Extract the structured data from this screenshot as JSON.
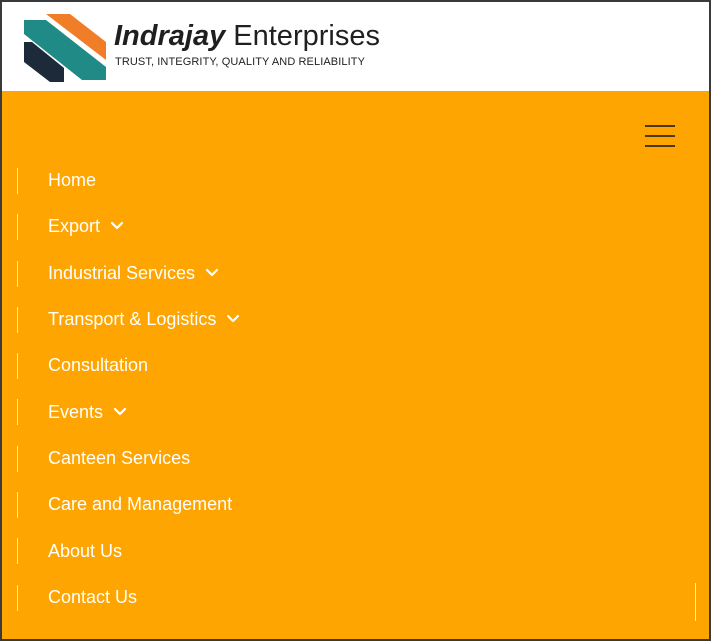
{
  "header": {
    "brand_strong": "Indrajay",
    "brand_light": "Enterprises",
    "tagline": "TRUST, INTEGRITY, QUALITY AND RELIABILITY",
    "logo_icon": "indrajay-logo-icon"
  },
  "colors": {
    "nav_background": "#fea501",
    "logo_teal": "#1f8a86",
    "logo_orange": "#f07d27",
    "logo_navy": "#1c2a3a",
    "menu_text": "#ffffff"
  },
  "nav": {
    "toggle_icon": "hamburger-menu-icon",
    "items": [
      {
        "label": "Home",
        "has_dropdown": false
      },
      {
        "label": "Export",
        "has_dropdown": true
      },
      {
        "label": "Industrial Services",
        "has_dropdown": true
      },
      {
        "label": "Transport & Logistics",
        "has_dropdown": true
      },
      {
        "label": "Consultation",
        "has_dropdown": false
      },
      {
        "label": "Events",
        "has_dropdown": true
      },
      {
        "label": "Canteen Services",
        "has_dropdown": false
      },
      {
        "label": "Care and Management",
        "has_dropdown": false
      },
      {
        "label": "About Us",
        "has_dropdown": false
      },
      {
        "label": "Contact Us",
        "has_dropdown": false
      }
    ]
  }
}
